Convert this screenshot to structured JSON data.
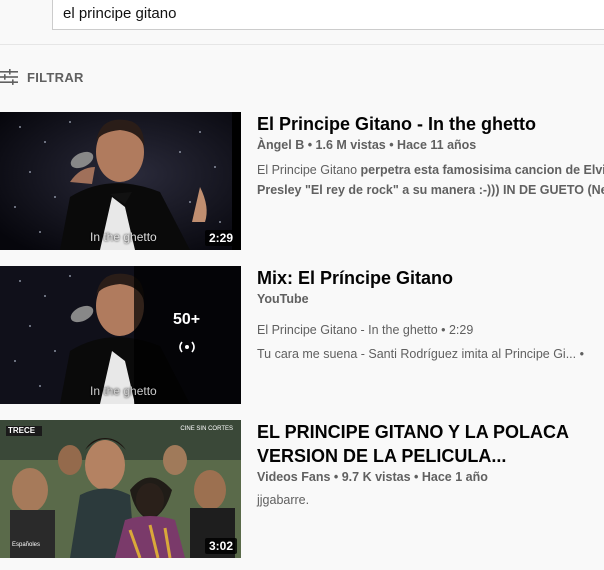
{
  "search": {
    "query": "el principe gitano"
  },
  "filter": {
    "label": "FILTRAR",
    "icon": "filter-sliders-icon"
  },
  "videos": [
    {
      "title": "El Principe Gitano - In the ghetto",
      "meta": "Àngel B • 1.6 M vistas • Hace 11 años",
      "desc_line1_a": "El Principe Gitano ",
      "desc_line1_b": "perpetra esta famosisima cancion de Elvi",
      "desc_line2": "Presley \"El rey de rock\" a su manera :-))) IN DE GUETO (New",
      "duration": "2:29",
      "caption": "In the ghetto"
    },
    {
      "title": "Mix: El Príncipe Gitano",
      "meta": "YouTube",
      "item1": "El Principe Gitano - In the ghetto • 2:29",
      "item2": "Tu cara me suena - Santi Rodríguez imita al Principe Gi...  •",
      "count": "50+",
      "caption": "In the ghetto"
    },
    {
      "title_line1": "EL PRINCIPE GITANO Y LA POLACA",
      "title_line2": "VERSION DE LA PELICULA...",
      "meta": "Videos Fans • 9.7 K vistas • Hace 1 año",
      "desc": "jjgabarre.",
      "duration": "3:02",
      "channel_logo": "TRECE",
      "overlay_tr": "CINE SIN CORTES",
      "overlay_bl": "Españoles"
    }
  ],
  "colors": {
    "bg": "#f9f9f9",
    "title": "#030303",
    "secondary": "#606060"
  }
}
